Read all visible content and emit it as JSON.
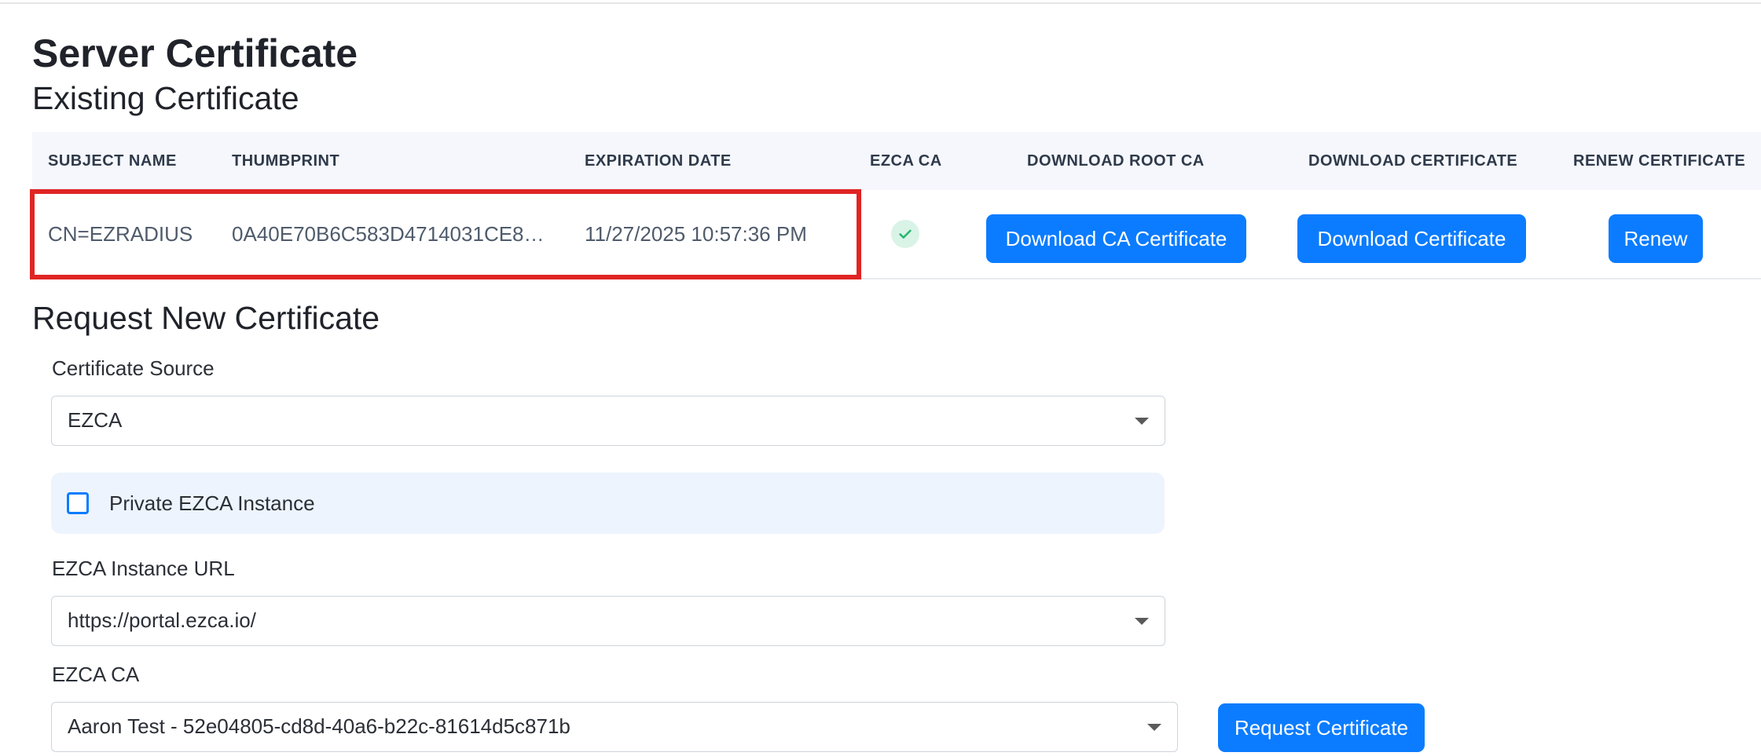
{
  "page": {
    "title": "Server Certificate"
  },
  "existing": {
    "title": "Existing Certificate",
    "columns": [
      "SUBJECT NAME",
      "THUMBPRINT",
      "EXPIRATION DATE",
      "EZCA CA",
      "DOWNLOAD ROOT CA",
      "DOWNLOAD CERTIFICATE",
      "RENEW CERTIFICATE"
    ],
    "row": {
      "subject_name": "CN=EZRADIUS",
      "thumbprint": "0A40E70B6C583D4714031CE82...",
      "expiration_date": "11/27/2025 10:57:36 PM",
      "ezca_ca_icon": "check-circle-icon",
      "download_ca_label": "Download CA Certificate",
      "download_cert_label": "Download Certificate",
      "renew_label": "Renew"
    }
  },
  "request": {
    "title": "Request New Certificate",
    "source_label": "Certificate Source",
    "source_value": "EZCA",
    "private_label": "Private EZCA Instance",
    "private_checked": false,
    "instance_url_label": "EZCA Instance URL",
    "instance_url_value": "https://portal.ezca.io/",
    "ca_label": "EZCA CA",
    "ca_value": "Aaron Test - 52e04805-cd8d-40a6-b22c-81614d5c871b",
    "request_button_label": "Request Certificate"
  },
  "colors": {
    "primary": "#0b7cff",
    "highlight": "#e02424",
    "success_bg": "#d9f4e7",
    "success": "#2bb673",
    "table_header_bg": "#f5f7fc",
    "panel_bg": "#edf4fd"
  }
}
